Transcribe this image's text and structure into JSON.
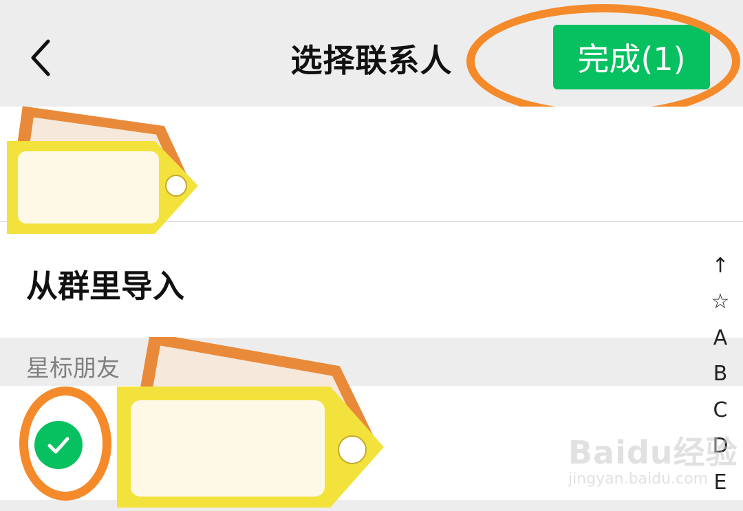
{
  "header": {
    "title": "选择联系人",
    "done_label": "完成(1)",
    "back_icon": "chevron-left-icon"
  },
  "rows": {
    "friend_label_partial": "友",
    "import_label": "从群里导入"
  },
  "section": {
    "starred_label": "星标朋友"
  },
  "index_bar": {
    "items": [
      "↑",
      "☆",
      "A",
      "B",
      "C",
      "D",
      "E"
    ]
  },
  "watermark": {
    "logo": "Baidu经验",
    "url": "jingyan.baidu.com"
  },
  "colors": {
    "accent_green": "#07c160",
    "highlight_orange": "#f58a2b",
    "tag_yellow": "#f3e23c",
    "tag_orange": "#e98a3a",
    "header_bg": "#ededed"
  }
}
